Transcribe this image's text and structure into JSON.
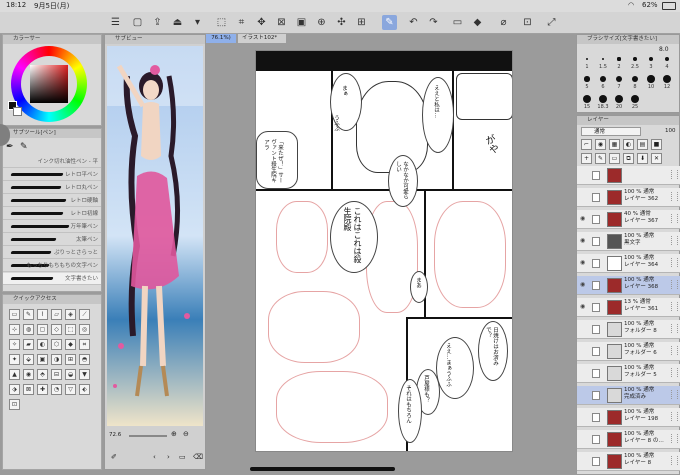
{
  "status": {
    "time": "18:12",
    "date": "9月5日(月)",
    "battery": "62%"
  },
  "document_tabs": {
    "zoom": "76.1",
    "title": "イラスト102*"
  },
  "color_panel": {
    "title": "カラーサー"
  },
  "subtool_panel": {
    "title": "サブツール[ペン]",
    "brushes": [
      {
        "label": "インク切れ油性ペン - 平",
        "width": 0
      },
      {
        "label": "レトロ平ペン",
        "width": 52
      },
      {
        "label": "レトロ丸ペン",
        "width": 50
      },
      {
        "label": "レトロ硬軸",
        "width": 55
      },
      {
        "label": "レトロ初線",
        "width": 52
      },
      {
        "label": "万年筆ペン",
        "width": 58
      },
      {
        "label": "太筆ペン",
        "width": 45
      },
      {
        "label": "ぷりっとさらっと",
        "width": 40
      },
      {
        "label": "もっちりもちもちの文字ペン",
        "width": 38
      },
      {
        "label": "文字書きたい",
        "width": 42
      }
    ]
  },
  "quick_access": {
    "title": "クイックアクセス"
  },
  "subview": {
    "title": "サブビュー",
    "zoom": "72.6"
  },
  "brush_size": {
    "title": "ブラシサイズ[文字書きたい]",
    "value": "8.0",
    "sizes": [
      "1",
      "1.5",
      "2",
      "2.5",
      "3",
      "4",
      "5",
      "6",
      "7",
      "8",
      "10",
      "12",
      "15",
      "18.3",
      "20",
      "25"
    ]
  },
  "layer_panel": {
    "title": "レイヤー",
    "blend_mode": "通常",
    "opacity": "100",
    "layers": [
      {
        "line1": "",
        "line2": "",
        "visible": false,
        "color": "#9c2a2a",
        "selected": false
      },
      {
        "line1": "100 % 通常",
        "line2": "レイヤー 362",
        "visible": false,
        "color": "#9c2a2a",
        "selected": false
      },
      {
        "line1": "40 % 通常",
        "line2": "レイヤー 367",
        "visible": true,
        "color": "#9c2a2a",
        "selected": false
      },
      {
        "line1": "100 % 通常",
        "line2": "黒文字",
        "visible": true,
        "color": "#555555",
        "selected": false
      },
      {
        "line1": "100 % 通常",
        "line2": "レイヤー 364",
        "visible": true,
        "color": "#ffffff",
        "selected": false
      },
      {
        "line1": "100 % 通常",
        "line2": "レイヤー 368",
        "visible": true,
        "color": "#9c2a2a",
        "selected": true
      },
      {
        "line1": "13 % 通常",
        "line2": "レイヤー 361",
        "visible": true,
        "color": "#9c2a2a",
        "selected": false
      },
      {
        "line1": "100 % 通常",
        "line2": "フォルダー 8",
        "visible": false,
        "color": "#d9d9d9",
        "selected": false
      },
      {
        "line1": "100 % 通常",
        "line2": "フォルダー 6",
        "visible": false,
        "color": "#d9d9d9",
        "selected": false
      },
      {
        "line1": "100 % 通常",
        "line2": "フォルダー 5",
        "visible": false,
        "color": "#d9d9d9",
        "selected": false
      },
      {
        "line1": "100 % 通常",
        "line2": "完成済み",
        "visible": false,
        "color": "#d9d9d9",
        "selected": true
      },
      {
        "line1": "100 % 通常",
        "line2": "レイヤー 198",
        "visible": false,
        "color": "#9c2a2a",
        "selected": false
      },
      {
        "line1": "100 % 通常",
        "line2": "レイヤー 8 の…",
        "visible": false,
        "color": "#9c2a2a",
        "selected": false
      },
      {
        "line1": "100 % 通常",
        "line2": "レイヤー 8",
        "visible": false,
        "color": "#9c2a2a",
        "selected": false
      }
    ]
  },
  "manga_text": [
    "まぁ",
    "うふふ",
    "ええと私は…",
    "「来たぜ！」サーヴァント殺生院キアラ",
    "がや",
    "これはこれは殺生院殿",
    "なかなか可愛らしい",
    "まあ",
    "日焼けはお済みで？",
    "ええ…まぁうふふ",
    "芦屋様も？",
    "それはもちろん"
  ],
  "colors": {
    "accent": "#7c9ad8",
    "bg": "#9b9b9b",
    "panel": "#d9d9d9"
  }
}
